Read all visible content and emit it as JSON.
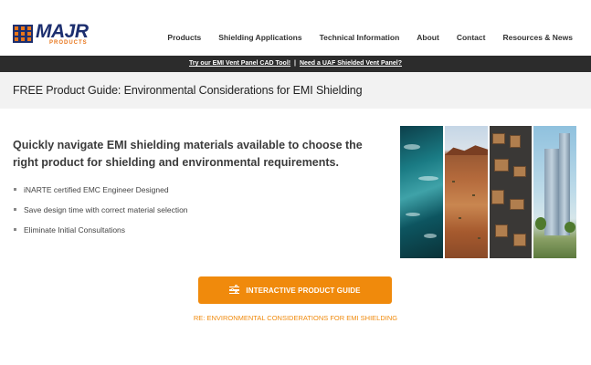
{
  "logo": {
    "wordmark": "MAJR",
    "subtext": "PRODUCTS",
    "icon": "majr-logo-icon",
    "brand_color": "#1d2f6f",
    "accent_color": "#e8751a"
  },
  "nav": {
    "items": [
      {
        "label": "Products"
      },
      {
        "label": "Shielding Applications"
      },
      {
        "label": "Technical Information"
      },
      {
        "label": "About"
      },
      {
        "label": "Contact"
      },
      {
        "label": "Resources & News"
      }
    ]
  },
  "announce": {
    "link1": "Try our EMI Vent Panel CAD Tool!",
    "separator": "|",
    "link2": "Need a UAF Shielded Vent Panel?"
  },
  "page": {
    "title": "FREE Product Guide: Environmental Considerations for EMI Shielding",
    "headline": "Quickly navigate EMI shielding materials available to choose the right product for shielding and environmental requirements.",
    "bullets": [
      "iNARTE certified EMC Engineer Designed",
      "Save design time with correct material selection",
      "Eliminate Initial Consultations"
    ]
  },
  "collage": {
    "panels": [
      "ocean-waves-image",
      "desert-landscape-image",
      "warehouse-boxes-image",
      "city-tower-image"
    ]
  },
  "cta": {
    "label": "INTERACTIVE PRODUCT GUIDE",
    "icon": "sliders-icon",
    "color": "#f08a0c"
  },
  "sub_link": {
    "label": "RE: ENVIRONMENTAL CONSIDERATIONS FOR EMI SHIELDING"
  }
}
